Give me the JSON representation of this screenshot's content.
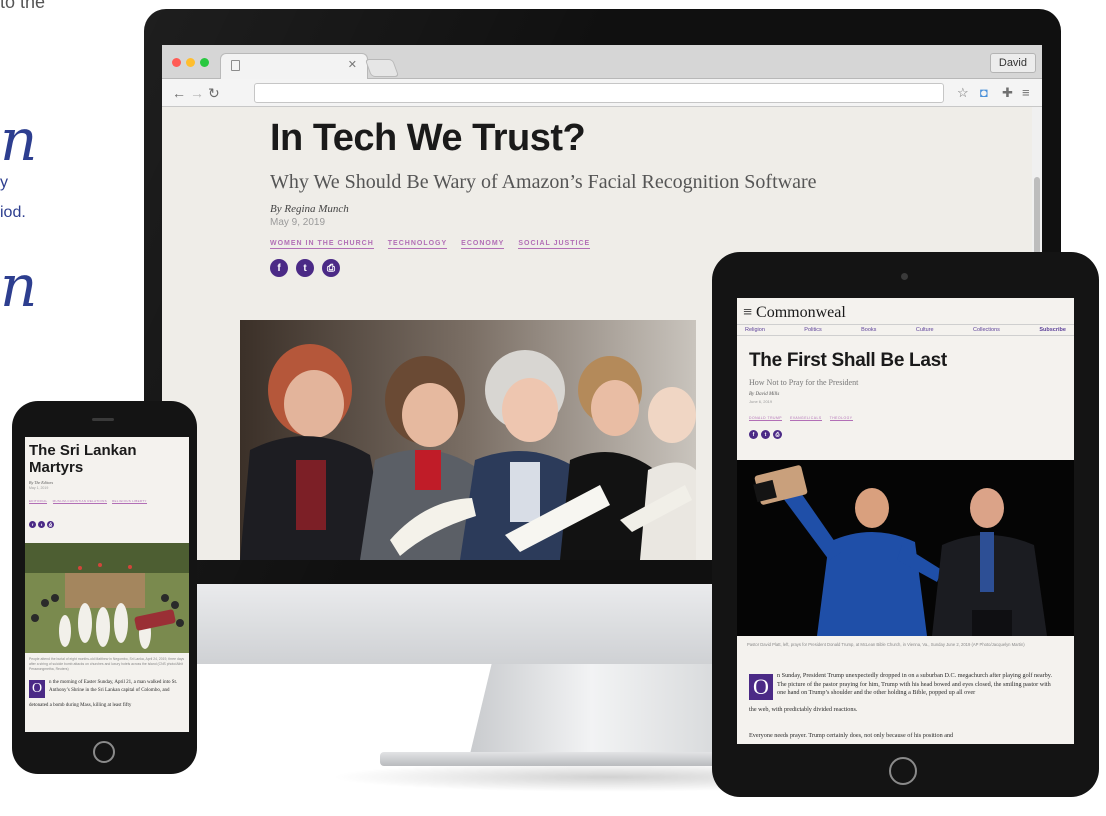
{
  "marketing": {
    "top_fragment": "to the",
    "big_fragment_1": "n",
    "line_1": "y",
    "line_2": "iod.",
    "big_fragment_2": "n"
  },
  "browser": {
    "user_button": "David",
    "toolbar_icons": [
      "star-icon",
      "camera-icon",
      "extension-icon",
      "menu-icon"
    ]
  },
  "desktop_article": {
    "title": "In Tech We Trust?",
    "subtitle": "Why We Should Be Wary of Amazon’s Facial Recognition Software",
    "byline": "By Regina Munch",
    "date": "May 9, 2019",
    "tags": [
      "WOMEN IN THE CHURCH",
      "TECHNOLOGY",
      "ECONOMY",
      "SOCIAL JUSTICE"
    ],
    "share_icons": [
      "facebook-icon",
      "twitter-icon",
      "print-icon"
    ]
  },
  "tablet_article": {
    "masthead": "≡ Commonweal",
    "nav": [
      "Religion",
      "Politics",
      "Books",
      "Culture",
      "Collections"
    ],
    "subscribe": "Subscribe",
    "title": "The First Shall Be Last",
    "subtitle": "How Not to Pray for the President",
    "byline": "By David Mills",
    "date": "June 6, 2019",
    "tags": [
      "DONALD TRUMP",
      "EVANGELICALS",
      "THEOLOGY"
    ],
    "caption": "Pastor David Platt, left, prays for President Donald Trump, at McLean Bible Church, in Vienna, Va., Sunday June 2, 2019 (AP Photo/Jacquelyn Martin)",
    "dropcap": "O",
    "body_1": "n Sunday, President Trump unexpectedly dropped in on a suburban D.C. megachurch after playing golf nearby. The picture of the pastor praying for him, Trump with his head bowed and eyes closed, the smiling pastor with one hand on Trump’s shoulder and the other holding a Bible, popped up all over",
    "body_2": "the web, with predictably divided reactions.",
    "body_3": "Everyone needs prayer. Trump certainly does, not only because of his position and"
  },
  "phone_article": {
    "title": "The Sri Lankan Martyrs",
    "byline": "By The Editors",
    "date": "May 1, 2019",
    "tags": [
      "EDITORIAL",
      "MUSLIM-CHRISTIAN RELATIONS",
      "RELIGIOUS LIBERTY"
    ],
    "caption": "People attend the burial of eight months-old Matthew in Negombo, Sri Lanka, April 24, 2019, three days after a string of suicide bomb attacks on churches and luxury hotels across the island (CNS photo/Athit Perawongmetha, Reuters)",
    "dropcap": "O",
    "body_1": "n the morning of Easter Sunday, April 21, a man walked into St. Anthony’s Shrine in the Sri Lankan capital of Colombo, and",
    "body_2": "detonated a bomb during Mass, killing at least fifty"
  },
  "colors": {
    "accent_purple": "#4b2a86",
    "tag_pink": "#b26fb6",
    "marketing_blue": "#2d3e8f"
  }
}
